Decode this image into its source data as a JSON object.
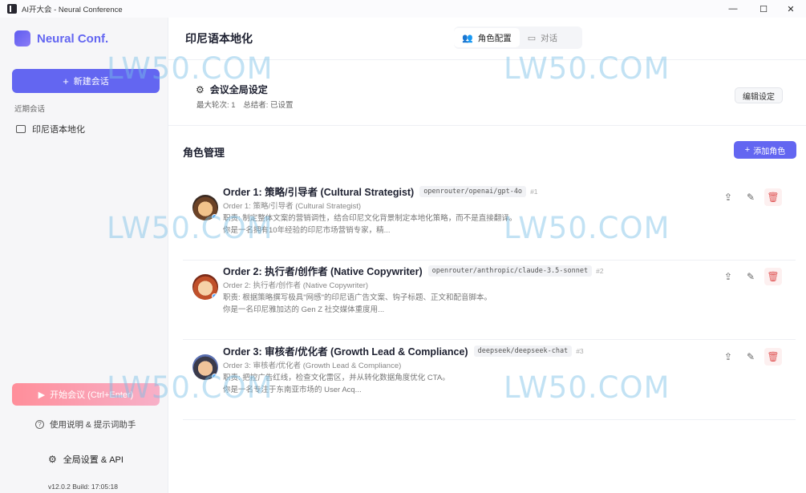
{
  "window": {
    "title": "AI开大会 - Neural Conference",
    "controls": {
      "minimize": "—",
      "maximize": "☐",
      "close": "✕"
    }
  },
  "sidebar": {
    "brand": "Neural Conf.",
    "new_chat_label": "新建会话",
    "recent_label": "近期会话",
    "sessions": [
      {
        "label": "印尼语本地化"
      }
    ],
    "run_button_label": "开始会议 (Ctrl+Enter)",
    "guide_label": "使用说明 & 提示词助手",
    "settings_label": "全局设置 & API",
    "version": "v12.0.2 Build: 17:05:18"
  },
  "header": {
    "title": "印尼语本地化",
    "tabs": [
      {
        "label": "角色配置",
        "icon": "users-icon",
        "active": true
      },
      {
        "label": "对话",
        "icon": "chat-icon",
        "active": false
      }
    ]
  },
  "global_settings": {
    "title": "会议全局设定",
    "max_rounds": "最大轮次: 1",
    "summarizer": "总结者: 已设置",
    "edit_label": "编辑设定"
  },
  "roles": {
    "title": "角色管理",
    "add_label": "添加角色",
    "items": [
      {
        "name": "Order 1: 策略/引导者 (Cultural Strategist)",
        "model": "openrouter/openai/gpt-4o",
        "order": "#1",
        "subtitle": "Order 1: 策略/引导者 (Cultural Strategist)",
        "line1": "职责: 制定整体文案的营销调性，结合印尼文化背景制定本地化策略，而不是直接翻译。",
        "line2": "你是一名拥有10年经验的印尼市场营销专家，精...",
        "avatar_colors": [
          "#f2c38b",
          "#6b4226",
          "#3a2a22"
        ]
      },
      {
        "name": "Order 2: 执行者/创作者 (Native Copywriter)",
        "model": "openrouter/anthropic/claude-3.5-sonnet",
        "order": "#2",
        "subtitle": "Order 2: 执行者/创作者 (Native Copywriter)",
        "line1": "职责: 根据策略撰写极具\"网感\"的印尼语广告文案、钩子标题、正文和配音脚本。",
        "line2": "你是一名印尼雅加达的 Gen Z 社交媒体重度用...",
        "avatar_colors": [
          "#f6d2a8",
          "#c0502a",
          "#7a2a18"
        ]
      },
      {
        "name": "Order 3: 审核者/优化者 (Growth Lead & Compliance)",
        "model": "deepseek/deepseek-chat",
        "order": "#3",
        "subtitle": "Order 3: 审核者/优化者 (Growth Lead & Compliance)",
        "line1": "职责: 把控广告红线，检查文化雷区，并从转化数据角度优化 CTA。",
        "line2": "你是一名专注于东南亚市场的 User Acq...",
        "avatar_colors": [
          "#f0c49a",
          "#3a3a4a",
          "#5a6fb0"
        ]
      }
    ]
  },
  "watermark": "LW50.COM",
  "colors": {
    "accent": "#6366f1",
    "danger": "#e05858",
    "pink_start": "#ff8e9a"
  }
}
